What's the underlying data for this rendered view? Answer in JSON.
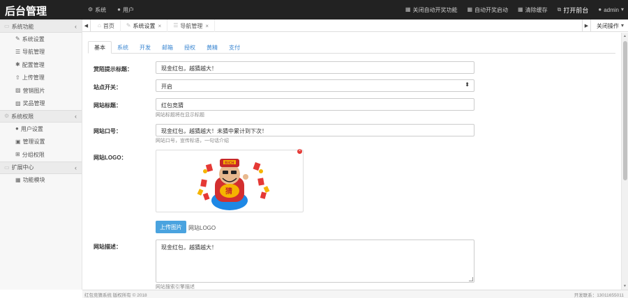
{
  "header": {
    "brand": "后台管理",
    "nav": [
      {
        "label": "系统",
        "icon": "gear-icon"
      },
      {
        "label": "用户",
        "icon": "user-icon"
      }
    ],
    "right": [
      {
        "label": "关闭自动开奖功能",
        "icon": "grid-icon"
      },
      {
        "label": "自动开奖启动",
        "icon": "grid-icon"
      },
      {
        "label": "清除缓存",
        "icon": "grid-icon"
      },
      {
        "label": "打开前台",
        "icon": "external-icon"
      },
      {
        "label": "admin",
        "icon": "user-icon"
      }
    ]
  },
  "sidebar": {
    "groups": [
      {
        "title": "系统功能",
        "items": [
          "系统设置",
          "导航管理",
          "配置管理",
          "上传管理",
          "营销图片",
          "奖品管理"
        ]
      },
      {
        "title": "系统权限",
        "items": [
          "用户设置",
          "管理设置",
          "分组权限"
        ]
      },
      {
        "title": "扩展中心",
        "items": [
          "功能模块"
        ]
      }
    ]
  },
  "tabstrip": {
    "tabs": [
      {
        "label": "首页"
      },
      {
        "label": "系统设置"
      },
      {
        "label": "导航管理"
      }
    ],
    "close_ops": "关闭操作"
  },
  "form": {
    "subtabs": [
      "基本",
      "系统",
      "开发",
      "邮箱",
      "授权",
      "黄精",
      "支付"
    ],
    "fields": {
      "share_title": {
        "label": "赏陌提示标题：",
        "value": "现金红包，越猜越大！"
      },
      "site_switch": {
        "label": "站点开关：",
        "value": "开启"
      },
      "site_title": {
        "label": "网站标题：",
        "value": "红包竞猜",
        "help": "网站标题将在显示标题"
      },
      "site_slogan": {
        "label": "网站口号：",
        "value": "现金红包，越猜越大！未猜中累计到下次！",
        "help": "网站口号，宣传标语，一句话介绍"
      },
      "site_logo": {
        "label": "网站LOGO：",
        "upload_label": "上传图片",
        "upload_note": "网站LOGO"
      },
      "site_desc": {
        "label": "网站描述：",
        "value": "现金红包，越猜越大！",
        "help": "网站搜索引擎描述"
      }
    }
  },
  "footer": {
    "left": "红包竞猜系统 版权所有 © 2018",
    "right": "开发联系：13011655011"
  }
}
